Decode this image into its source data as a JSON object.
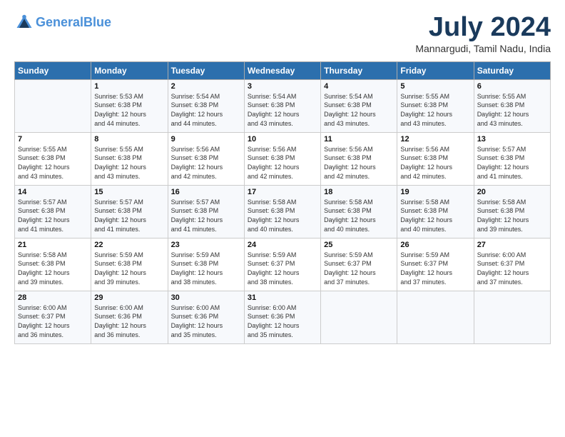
{
  "header": {
    "logo_line1": "General",
    "logo_line2": "Blue",
    "month_year": "July 2024",
    "location": "Mannargudi, Tamil Nadu, India"
  },
  "days_of_week": [
    "Sunday",
    "Monday",
    "Tuesday",
    "Wednesday",
    "Thursday",
    "Friday",
    "Saturday"
  ],
  "weeks": [
    [
      {
        "day": "",
        "info": ""
      },
      {
        "day": "1",
        "info": "Sunrise: 5:53 AM\nSunset: 6:38 PM\nDaylight: 12 hours\nand 44 minutes."
      },
      {
        "day": "2",
        "info": "Sunrise: 5:54 AM\nSunset: 6:38 PM\nDaylight: 12 hours\nand 44 minutes."
      },
      {
        "day": "3",
        "info": "Sunrise: 5:54 AM\nSunset: 6:38 PM\nDaylight: 12 hours\nand 43 minutes."
      },
      {
        "day": "4",
        "info": "Sunrise: 5:54 AM\nSunset: 6:38 PM\nDaylight: 12 hours\nand 43 minutes."
      },
      {
        "day": "5",
        "info": "Sunrise: 5:55 AM\nSunset: 6:38 PM\nDaylight: 12 hours\nand 43 minutes."
      },
      {
        "day": "6",
        "info": "Sunrise: 5:55 AM\nSunset: 6:38 PM\nDaylight: 12 hours\nand 43 minutes."
      }
    ],
    [
      {
        "day": "7",
        "info": "Sunrise: 5:55 AM\nSunset: 6:38 PM\nDaylight: 12 hours\nand 43 minutes."
      },
      {
        "day": "8",
        "info": "Sunrise: 5:55 AM\nSunset: 6:38 PM\nDaylight: 12 hours\nand 43 minutes."
      },
      {
        "day": "9",
        "info": "Sunrise: 5:56 AM\nSunset: 6:38 PM\nDaylight: 12 hours\nand 42 minutes."
      },
      {
        "day": "10",
        "info": "Sunrise: 5:56 AM\nSunset: 6:38 PM\nDaylight: 12 hours\nand 42 minutes."
      },
      {
        "day": "11",
        "info": "Sunrise: 5:56 AM\nSunset: 6:38 PM\nDaylight: 12 hours\nand 42 minutes."
      },
      {
        "day": "12",
        "info": "Sunrise: 5:56 AM\nSunset: 6:38 PM\nDaylight: 12 hours\nand 42 minutes."
      },
      {
        "day": "13",
        "info": "Sunrise: 5:57 AM\nSunset: 6:38 PM\nDaylight: 12 hours\nand 41 minutes."
      }
    ],
    [
      {
        "day": "14",
        "info": "Sunrise: 5:57 AM\nSunset: 6:38 PM\nDaylight: 12 hours\nand 41 minutes."
      },
      {
        "day": "15",
        "info": "Sunrise: 5:57 AM\nSunset: 6:38 PM\nDaylight: 12 hours\nand 41 minutes."
      },
      {
        "day": "16",
        "info": "Sunrise: 5:57 AM\nSunset: 6:38 PM\nDaylight: 12 hours\nand 41 minutes."
      },
      {
        "day": "17",
        "info": "Sunrise: 5:58 AM\nSunset: 6:38 PM\nDaylight: 12 hours\nand 40 minutes."
      },
      {
        "day": "18",
        "info": "Sunrise: 5:58 AM\nSunset: 6:38 PM\nDaylight: 12 hours\nand 40 minutes."
      },
      {
        "day": "19",
        "info": "Sunrise: 5:58 AM\nSunset: 6:38 PM\nDaylight: 12 hours\nand 40 minutes."
      },
      {
        "day": "20",
        "info": "Sunrise: 5:58 AM\nSunset: 6:38 PM\nDaylight: 12 hours\nand 39 minutes."
      }
    ],
    [
      {
        "day": "21",
        "info": "Sunrise: 5:58 AM\nSunset: 6:38 PM\nDaylight: 12 hours\nand 39 minutes."
      },
      {
        "day": "22",
        "info": "Sunrise: 5:59 AM\nSunset: 6:38 PM\nDaylight: 12 hours\nand 39 minutes."
      },
      {
        "day": "23",
        "info": "Sunrise: 5:59 AM\nSunset: 6:38 PM\nDaylight: 12 hours\nand 38 minutes."
      },
      {
        "day": "24",
        "info": "Sunrise: 5:59 AM\nSunset: 6:37 PM\nDaylight: 12 hours\nand 38 minutes."
      },
      {
        "day": "25",
        "info": "Sunrise: 5:59 AM\nSunset: 6:37 PM\nDaylight: 12 hours\nand 37 minutes."
      },
      {
        "day": "26",
        "info": "Sunrise: 5:59 AM\nSunset: 6:37 PM\nDaylight: 12 hours\nand 37 minutes."
      },
      {
        "day": "27",
        "info": "Sunrise: 6:00 AM\nSunset: 6:37 PM\nDaylight: 12 hours\nand 37 minutes."
      }
    ],
    [
      {
        "day": "28",
        "info": "Sunrise: 6:00 AM\nSunset: 6:37 PM\nDaylight: 12 hours\nand 36 minutes."
      },
      {
        "day": "29",
        "info": "Sunrise: 6:00 AM\nSunset: 6:36 PM\nDaylight: 12 hours\nand 36 minutes."
      },
      {
        "day": "30",
        "info": "Sunrise: 6:00 AM\nSunset: 6:36 PM\nDaylight: 12 hours\nand 35 minutes."
      },
      {
        "day": "31",
        "info": "Sunrise: 6:00 AM\nSunset: 6:36 PM\nDaylight: 12 hours\nand 35 minutes."
      },
      {
        "day": "",
        "info": ""
      },
      {
        "day": "",
        "info": ""
      },
      {
        "day": "",
        "info": ""
      }
    ]
  ]
}
